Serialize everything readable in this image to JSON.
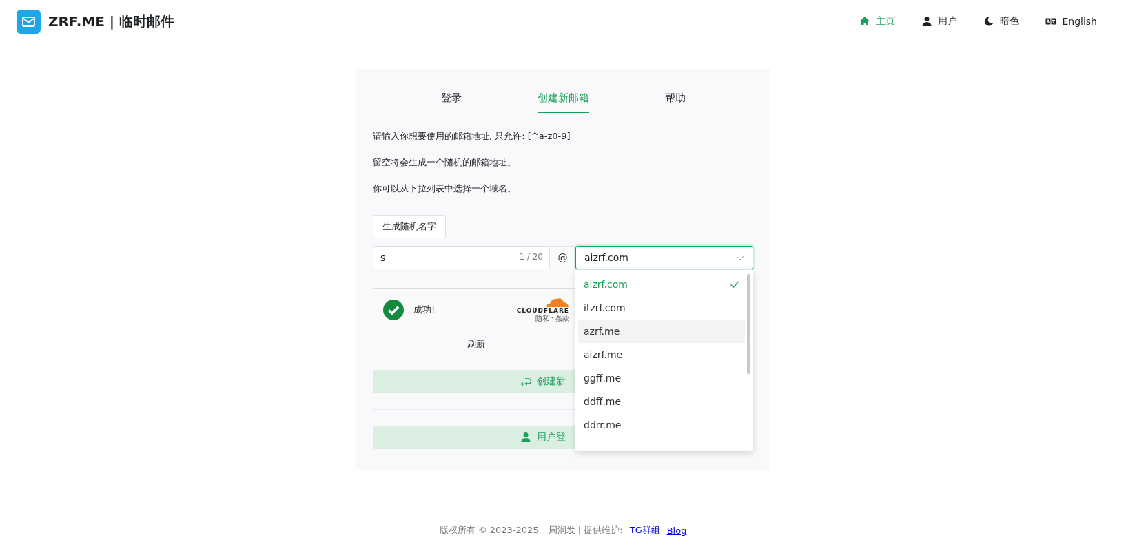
{
  "header": {
    "title": "ZRF.ME | 临时邮件",
    "nav": [
      {
        "label": "主页",
        "selected": true
      },
      {
        "label": "用户",
        "selected": false
      },
      {
        "label": "暗色",
        "selected": false
      },
      {
        "label": "English",
        "selected": false
      }
    ]
  },
  "tabs": [
    {
      "label": "登录",
      "selected": false
    },
    {
      "label": "创建新邮箱",
      "selected": true
    },
    {
      "label": "帮助",
      "selected": false
    }
  ],
  "hints": [
    "请输入你想要使用的邮箱地址, 只允许: [^a-z0-9]",
    "留空将会生成一个随机的邮箱地址。",
    "你可以从下拉列表中选择一个域名。"
  ],
  "random_button": "生成随机名字",
  "name_field": {
    "value": "s",
    "counter": "1 / 20"
  },
  "at": "@",
  "domain_select": {
    "value": "aizrf.com",
    "options": [
      {
        "label": "aizrf.com",
        "selected": true,
        "hovered": false
      },
      {
        "label": "itzrf.com",
        "selected": false,
        "hovered": false
      },
      {
        "label": "azrf.me",
        "selected": false,
        "hovered": true
      },
      {
        "label": "aizrf.me",
        "selected": false,
        "hovered": false
      },
      {
        "label": "ggff.me",
        "selected": false,
        "hovered": false
      },
      {
        "label": "ddff.me",
        "selected": false,
        "hovered": false
      },
      {
        "label": "ddrr.me",
        "selected": false,
        "hovered": false
      }
    ]
  },
  "captcha": {
    "status": "成功!",
    "brand": "CLOUDFLARE",
    "privacy": "隐私",
    "dot": "·",
    "terms": "条款"
  },
  "refresh": "刷新",
  "create_button": "创建新",
  "login_button": "用户登",
  "footer": {
    "copyright": "版权所有 © 2023-2025",
    "author": "周润发 | 提供维护:",
    "links": [
      "TG群组",
      "Blog"
    ]
  }
}
